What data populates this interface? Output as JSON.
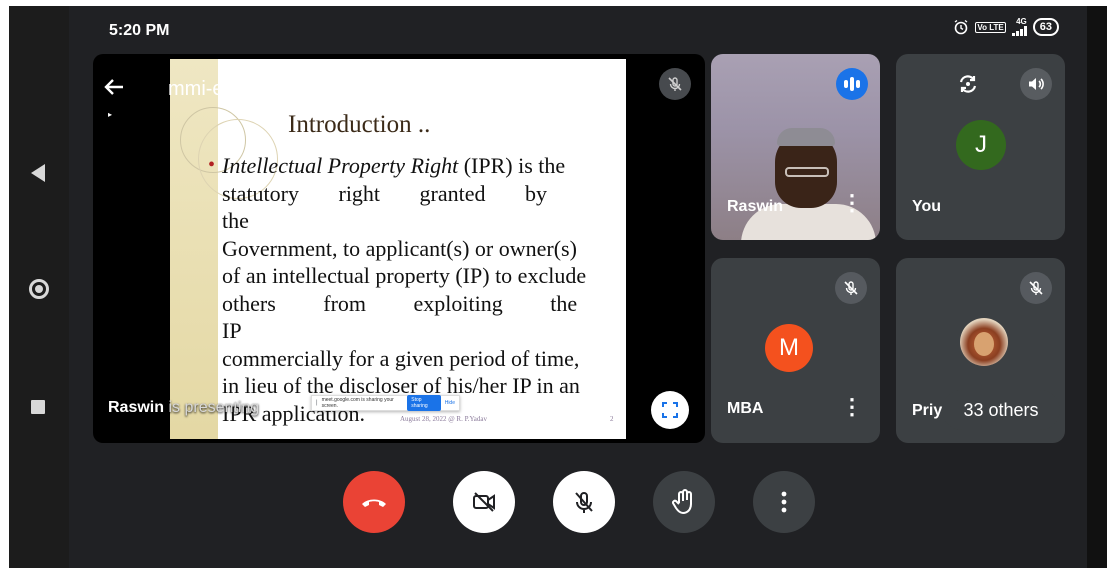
{
  "status_bar": {
    "time": "5:20 PM",
    "network": "4G",
    "volte": "Vo LTE",
    "battery": "63"
  },
  "presentation": {
    "meeting_code": "mmi-ecci-pnv",
    "presenting_name": "Raswin",
    "presenting_suffix": "is presenting",
    "slide": {
      "title": "Introduction ..",
      "body_italic": "Intellectual Property Right",
      "lines": [
        "(IPR) is the",
        "statutory right granted by the",
        "Government, to applicant(s) or owner(s)",
        "of an intellectual property (IP) to exclude",
        "others from exploiting the IP",
        "commercially for a given period of time,",
        "in lieu of the discloser of his/her IP in an",
        "IPR application."
      ],
      "footer": "August 28, 2022 @ R. P.Yadav",
      "page_number": "2",
      "share_bar": {
        "text": "meet.google.com is sharing your screen.",
        "stop_label": "Stop sharing",
        "hide_label": "Hide"
      }
    }
  },
  "participants": [
    {
      "name": "Raswin",
      "state": "speaking"
    },
    {
      "name": "You",
      "initial": "J",
      "avatar_color": "#33691e"
    },
    {
      "name": "MBA",
      "initial": "M",
      "avatar_color": "#f4511e",
      "muted": true
    },
    {
      "name": "Priya",
      "muted": true,
      "others_label": "33 others"
    }
  ],
  "colors": {
    "hangup": "#ea4335",
    "accent": "#1a73e8",
    "tile_bg": "#3c4043",
    "app_bg": "#202124"
  },
  "icons": {
    "hangup": "phone-hangup-icon",
    "camera": "camera-off-icon",
    "mic": "mic-off-icon",
    "hand": "raise-hand-icon",
    "more": "more-vert-icon"
  }
}
